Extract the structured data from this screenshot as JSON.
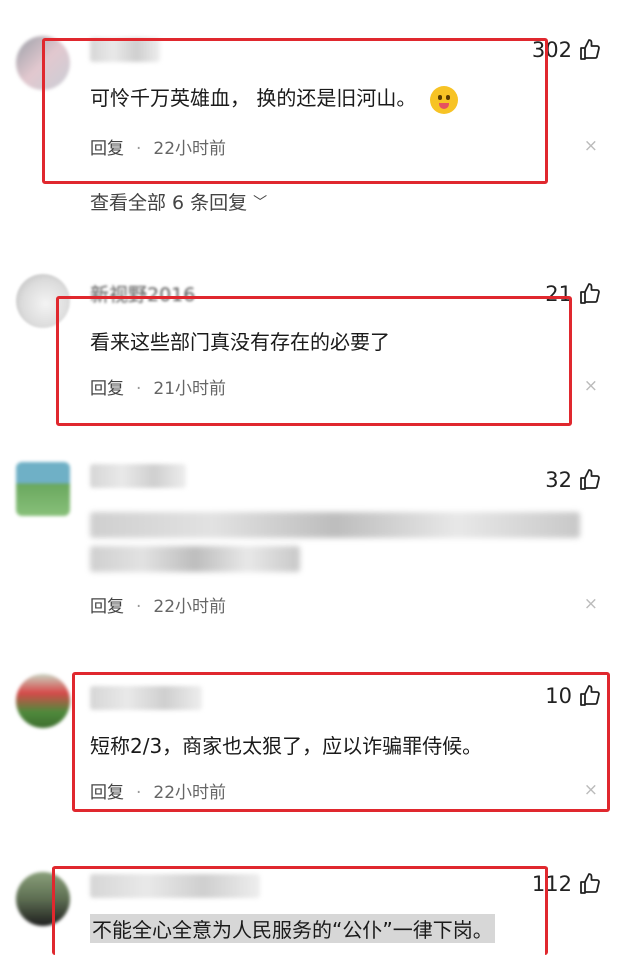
{
  "comments": [
    {
      "username": "",
      "likes": "302",
      "text": "可怜千万英雄血， 换的还是旧河山。",
      "reply_label": "回复",
      "separator": "·",
      "time": "22小时前",
      "close": "×",
      "view_all": "查看全部 6 条回复"
    },
    {
      "username": "新视野2016",
      "likes": "21",
      "text": "看来这些部门真没有存在的必要了",
      "reply_label": "回复",
      "separator": "·",
      "time": "21小时前",
      "close": "×"
    },
    {
      "username": "",
      "likes": "32",
      "text": "",
      "reply_label": "回复",
      "separator": "·",
      "time": "22小时前",
      "close": "×"
    },
    {
      "username": "",
      "likes": "10",
      "text": "短称2/3，商家也太狠了，应以诈骗罪侍候。",
      "reply_label": "回复",
      "separator": "·",
      "time": "22小时前",
      "close": "×"
    },
    {
      "username": "",
      "likes": "112",
      "text": "不能全心全意为人民服务的“公仆”一律下岗。"
    }
  ],
  "colors": {
    "highlight_box": "#e0282e",
    "meta_text": "#666666"
  },
  "icons": {
    "like": "thumbs-up-icon",
    "emoji": "zipper-mouth-emoji-icon",
    "chevron": "chevron-down-icon"
  }
}
